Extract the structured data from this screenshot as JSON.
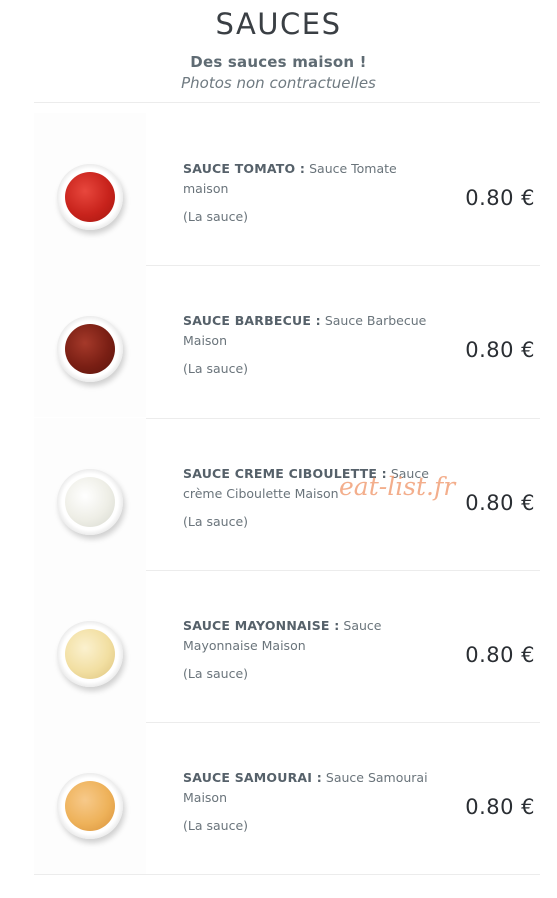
{
  "header": {
    "title": "SAUCES",
    "subtitle": "Des sauces maison !",
    "note": "Photos non contractuelles"
  },
  "items": [
    {
      "name": "SAUCE TOMATO :",
      "desc": "Sauce Tomate maison",
      "unit": "(La sauce)",
      "price": "0.80 €",
      "color": "#c8231c",
      "icon": "tomato-sauce-bowl-icon"
    },
    {
      "name": "SAUCE BARBECUE :",
      "desc": "Sauce Barbecue Maison",
      "unit": "(La sauce)",
      "price": "0.80 €",
      "color": "#7a1f14",
      "icon": "barbecue-sauce-bowl-icon"
    },
    {
      "name": "SAUCE CREME CIBOULETTE :",
      "desc": "Sauce crème Ciboulette Maison",
      "unit": "(La sauce)",
      "price": "0.80 €",
      "color": "#eeeee6",
      "icon": "chive-cream-sauce-bowl-icon"
    },
    {
      "name": "SAUCE MAYONNAISE :",
      "desc": "Sauce Mayonnaise Maison",
      "unit": "(La sauce)",
      "price": "0.80 €",
      "color": "#f2dfa2",
      "icon": "mayonnaise-sauce-bowl-icon"
    },
    {
      "name": "SAUCE SAMOURAI :",
      "desc": "Sauce Samourai Maison",
      "unit": "(La sauce)",
      "price": "0.80 €",
      "color": "#eeb25a",
      "icon": "samourai-sauce-bowl-icon"
    }
  ],
  "watermark": "eat-list.fr"
}
